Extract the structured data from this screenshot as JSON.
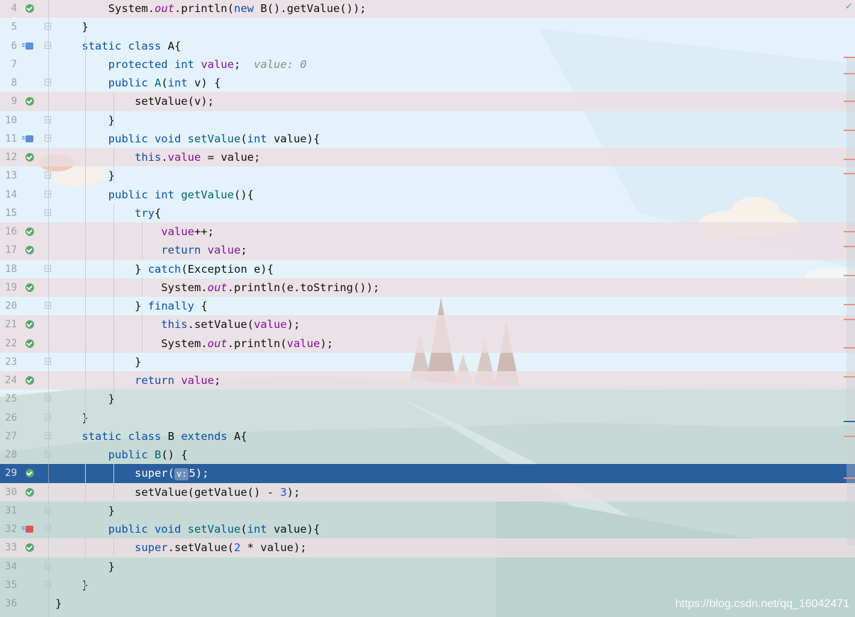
{
  "colors": {
    "sky": "#e4f3fb",
    "hills": "#c7dcd8",
    "selection": "#2a5f9e",
    "executed_line": "#ecdee2",
    "keyword": "#0b4fa8",
    "field": "#871094",
    "method": "#00627a",
    "number": "#1750eb"
  },
  "editor": {
    "analysis_status_icon": "check-icon",
    "selected_line": "29",
    "lines": [
      {
        "num": "4",
        "mark": "check",
        "hl": true,
        "t": [
          [
            "",
            "        System."
          ],
          [
            "st",
            "out"
          ],
          [
            "",
            ".println("
          ],
          [
            "kw",
            "new "
          ],
          [
            "",
            "B().getValue());"
          ]
        ]
      },
      {
        "num": "5",
        "fold": "close",
        "t": [
          [
            "",
            "    }"
          ]
        ]
      },
      {
        "num": "6",
        "mark": "override",
        "fold": "open",
        "t": [
          [
            "kw",
            "    static class "
          ],
          [
            "",
            "A{"
          ]
        ]
      },
      {
        "num": "7",
        "t": [
          [
            "kw",
            "        protected int "
          ],
          [
            "fld",
            "value"
          ],
          [
            "",
            ";  "
          ],
          [
            "hint",
            "value: 0"
          ]
        ]
      },
      {
        "num": "8",
        "fold": "open",
        "t": [
          [
            "kw",
            "        public "
          ],
          [
            "mt",
            "A"
          ],
          [
            "",
            "("
          ],
          [
            "kw",
            "int "
          ],
          [
            "",
            "v) {"
          ]
        ]
      },
      {
        "num": "9",
        "mark": "check",
        "hl": true,
        "t": [
          [
            "",
            "            setValue(v);"
          ]
        ]
      },
      {
        "num": "10",
        "fold": "close",
        "t": [
          [
            "",
            "        }"
          ]
        ]
      },
      {
        "num": "11",
        "mark": "override",
        "fold": "open",
        "t": [
          [
            "kw",
            "        public void "
          ],
          [
            "mt",
            "setValue"
          ],
          [
            "",
            "("
          ],
          [
            "kw",
            "int "
          ],
          [
            "",
            "value){"
          ]
        ]
      },
      {
        "num": "12",
        "mark": "check",
        "hl": true,
        "t": [
          [
            "kw",
            "            this"
          ],
          [
            "",
            "."
          ],
          [
            "fld",
            "value"
          ],
          [
            "",
            " = value;"
          ]
        ]
      },
      {
        "num": "13",
        "fold": "close",
        "t": [
          [
            "",
            "        }"
          ]
        ]
      },
      {
        "num": "14",
        "fold": "open",
        "t": [
          [
            "kw",
            "        public int "
          ],
          [
            "mt",
            "getValue"
          ],
          [
            "",
            "(){"
          ]
        ]
      },
      {
        "num": "15",
        "fold": "open",
        "t": [
          [
            "kw",
            "            try"
          ],
          [
            "",
            "{"
          ]
        ]
      },
      {
        "num": "16",
        "mark": "check",
        "hl": true,
        "t": [
          [
            "fld",
            "                value"
          ],
          [
            "",
            "++;"
          ]
        ]
      },
      {
        "num": "17",
        "mark": "check",
        "hl": true,
        "t": [
          [
            "kw",
            "                return "
          ],
          [
            "fld",
            "value"
          ],
          [
            "",
            ";"
          ]
        ]
      },
      {
        "num": "18",
        "fold": "open",
        "t": [
          [
            "",
            "            } "
          ],
          [
            "kw",
            "catch"
          ],
          [
            "",
            "(Exception e){"
          ]
        ]
      },
      {
        "num": "19",
        "mark": "check",
        "hl": true,
        "t": [
          [
            "",
            "                System."
          ],
          [
            "st",
            "out"
          ],
          [
            "",
            ".println(e.toString());"
          ]
        ]
      },
      {
        "num": "20",
        "fold": "close",
        "t": [
          [
            "",
            "            } "
          ],
          [
            "kw",
            "finally "
          ],
          [
            "",
            "{"
          ]
        ]
      },
      {
        "num": "21",
        "mark": "check",
        "hl": true,
        "t": [
          [
            "kw",
            "                this"
          ],
          [
            "",
            ".setValue("
          ],
          [
            "fld",
            "value"
          ],
          [
            "",
            ");"
          ]
        ]
      },
      {
        "num": "22",
        "mark": "check",
        "hl": true,
        "t": [
          [
            "",
            "                System."
          ],
          [
            "st",
            "out"
          ],
          [
            "",
            ".println("
          ],
          [
            "fld",
            "value"
          ],
          [
            "",
            ");"
          ]
        ]
      },
      {
        "num": "23",
        "fold": "close",
        "t": [
          [
            "",
            "            }"
          ]
        ]
      },
      {
        "num": "24",
        "mark": "check",
        "hl": true,
        "t": [
          [
            "kw",
            "            return "
          ],
          [
            "fld",
            "value"
          ],
          [
            "",
            ";"
          ]
        ]
      },
      {
        "num": "25",
        "fold": "close",
        "t": [
          [
            "",
            "        }"
          ]
        ]
      },
      {
        "num": "26",
        "fold": "close",
        "t": [
          [
            "",
            "    }"
          ]
        ]
      },
      {
        "num": "27",
        "fold": "open",
        "t": [
          [
            "kw",
            "    static class "
          ],
          [
            "",
            "B "
          ],
          [
            "kw",
            "extends "
          ],
          [
            "",
            "A{"
          ]
        ]
      },
      {
        "num": "28",
        "fold": "open",
        "t": [
          [
            "kw",
            "        public "
          ],
          [
            "mt",
            "B"
          ],
          [
            "",
            "() {"
          ]
        ]
      },
      {
        "num": "29",
        "mark": "check",
        "sel": true,
        "t": [
          [
            "",
            "            super("
          ],
          [
            "param",
            "v:"
          ],
          [
            "",
            "5);"
          ]
        ]
      },
      {
        "num": "30",
        "mark": "check",
        "hl": true,
        "t": [
          [
            "",
            "            setValue(getValue() - "
          ],
          [
            "num",
            "3"
          ],
          [
            "",
            ");"
          ]
        ]
      },
      {
        "num": "31",
        "fold": "close",
        "t": [
          [
            "",
            "        }"
          ]
        ]
      },
      {
        "num": "32",
        "mark": "override-red",
        "fold": "open",
        "t": [
          [
            "kw",
            "        public void "
          ],
          [
            "mt",
            "setValue"
          ],
          [
            "",
            "("
          ],
          [
            "kw",
            "int "
          ],
          [
            "",
            "value){"
          ]
        ]
      },
      {
        "num": "33",
        "mark": "check",
        "hl": true,
        "t": [
          [
            "kw",
            "            super"
          ],
          [
            "",
            ".setValue("
          ],
          [
            "num",
            "2"
          ],
          [
            "",
            " * value);"
          ]
        ]
      },
      {
        "num": "34",
        "fold": "close",
        "t": [
          [
            "",
            "        }"
          ]
        ]
      },
      {
        "num": "35",
        "fold": "close",
        "t": [
          [
            "",
            "    }"
          ]
        ]
      },
      {
        "num": "36",
        "t": [
          [
            "",
            "}"
          ]
        ]
      }
    ]
  },
  "watermark": "https://blog.csdn.net/qq_16042471"
}
